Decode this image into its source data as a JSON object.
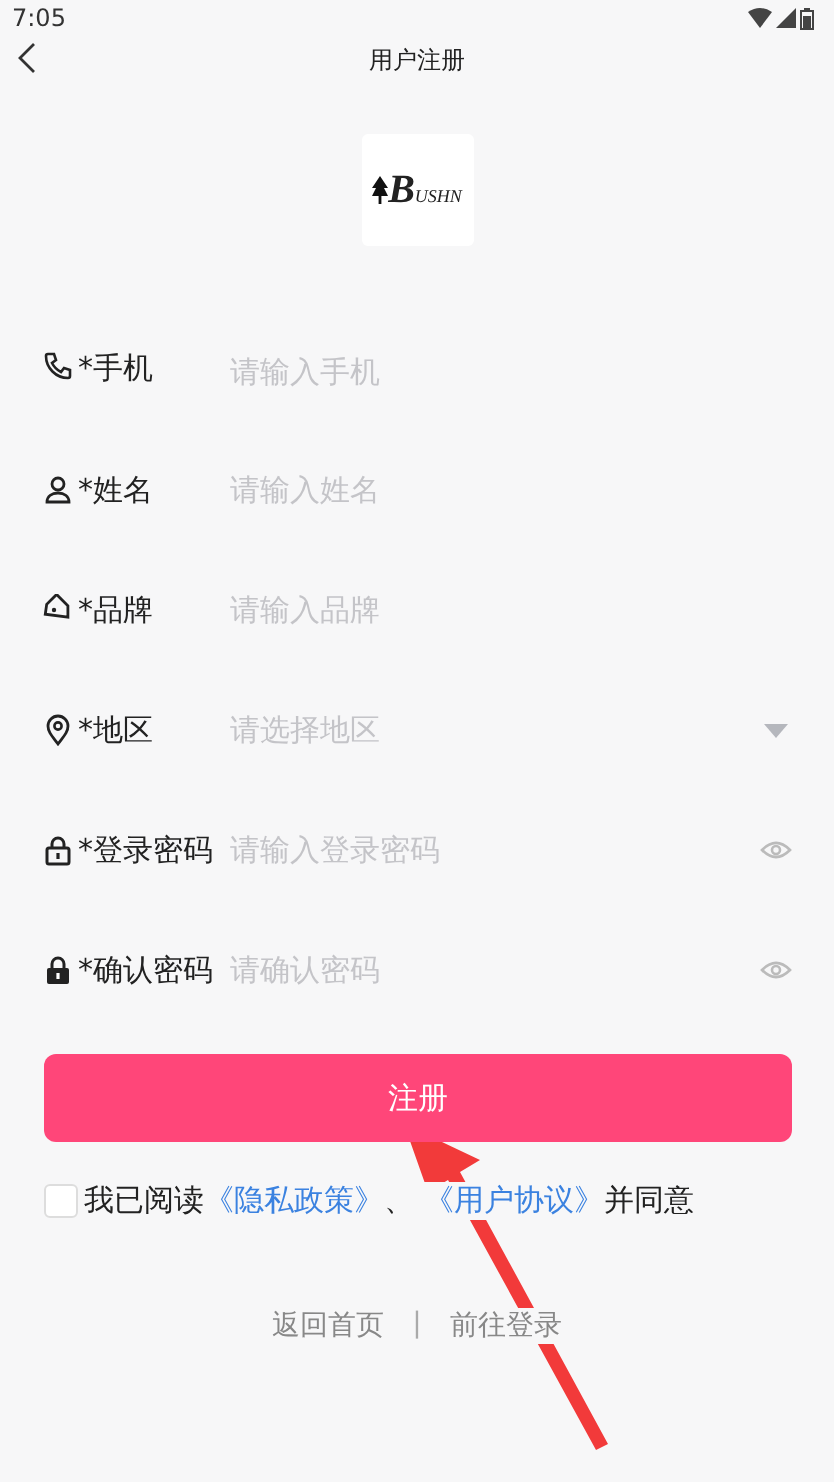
{
  "status_bar": {
    "time": "7:05"
  },
  "header": {
    "title": "用户注册"
  },
  "logo": {
    "mark": "B",
    "text": "USHN"
  },
  "fields": [
    {
      "kind": "input",
      "label": "*手机",
      "placeholder": "请输入手机"
    },
    {
      "kind": "input",
      "label": "*姓名",
      "placeholder": "请输入姓名"
    },
    {
      "kind": "input",
      "label": "*品牌",
      "placeholder": "请输入品牌"
    },
    {
      "kind": "select",
      "label": "*地区",
      "placeholder": "请选择地区"
    },
    {
      "kind": "password",
      "label": "*登录密码",
      "placeholder": "请输入登录密码"
    },
    {
      "kind": "password",
      "label": "*确认密码",
      "placeholder": "请确认密码"
    }
  ],
  "submit_button": "注册",
  "agreement": {
    "checked": false,
    "prefix": "我已阅读",
    "link_1": "《隐私政策》",
    "separator": "、",
    "link_2": "《用户协议》",
    "suffix": "并同意"
  },
  "footer": {
    "link_1": "返回首页",
    "divider": "|",
    "link_2": "前往登录"
  }
}
